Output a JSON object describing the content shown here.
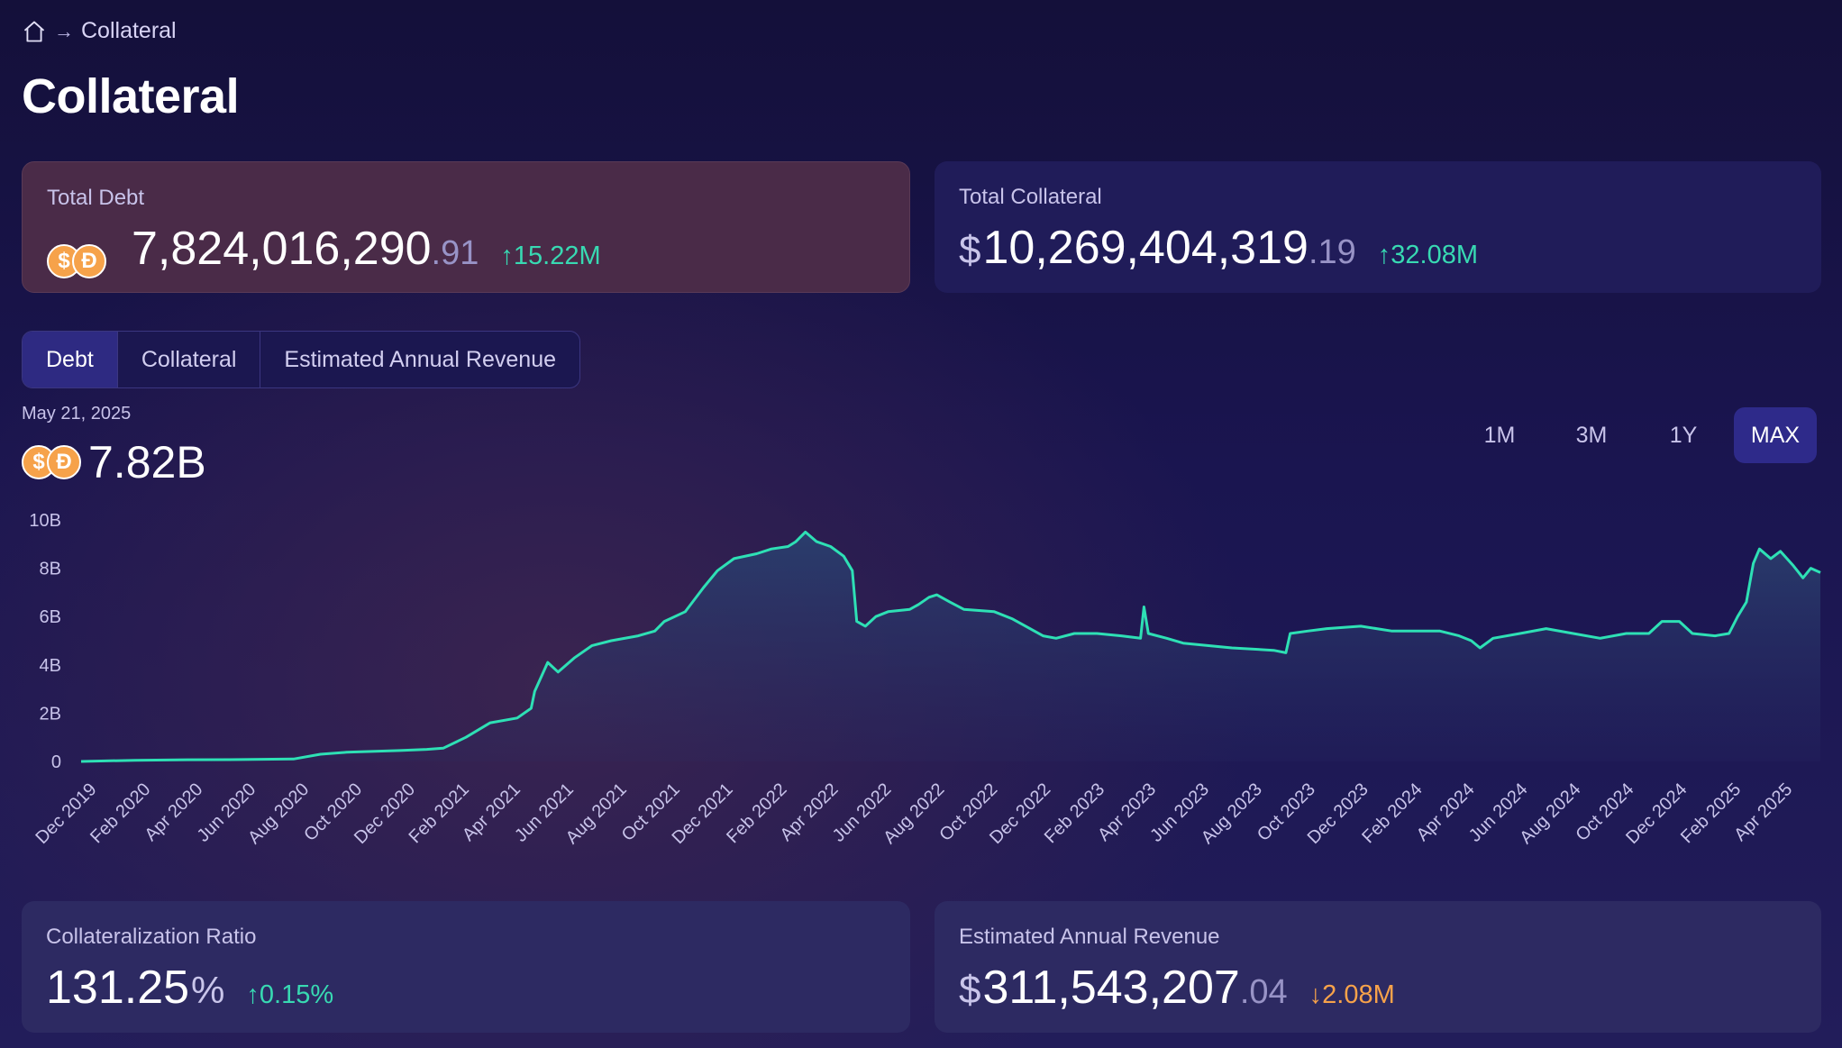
{
  "breadcrumb": {
    "current": "Collateral"
  },
  "page_title": "Collateral",
  "total_debt": {
    "label": "Total Debt",
    "value": "7,824,016,290",
    "cents": ".91",
    "change": "↑15.22M"
  },
  "total_collateral": {
    "label": "Total Collateral",
    "currency": "$",
    "value": "10,269,404,319",
    "cents": ".19",
    "change": "↑32.08M"
  },
  "tabs": [
    {
      "label": "Debt",
      "active": true
    },
    {
      "label": "Collateral",
      "active": false
    },
    {
      "label": "Estimated Annual Revenue",
      "active": false
    }
  ],
  "selected": {
    "date": "May 21, 2025",
    "value": "7.82B"
  },
  "ranges": [
    {
      "label": "1M",
      "active": false
    },
    {
      "label": "3M",
      "active": false
    },
    {
      "label": "1Y",
      "active": false
    },
    {
      "label": "MAX",
      "active": true
    }
  ],
  "collateralization_ratio": {
    "label": "Collateralization Ratio",
    "value": "131.25",
    "unit": "%",
    "change": "↑0.15%"
  },
  "estimated_annual_revenue": {
    "label": "Estimated Annual Revenue",
    "currency": "$",
    "value": "311,543,207",
    "cents": ".04",
    "change": "↓2.08M"
  },
  "colors": {
    "line": "#2ee0b5",
    "up": "#38d9b2",
    "down": "#f7a24a",
    "coin": "#f6a24a"
  },
  "chart_data": {
    "type": "area",
    "ylim": [
      0,
      10
    ],
    "y_ticks": [
      "10B",
      "8B",
      "6B",
      "4B",
      "2B",
      "0"
    ],
    "x_ticks": [
      "Dec 2019",
      "Feb 2020",
      "Apr 2020",
      "Jun 2020",
      "Aug 2020",
      "Oct 2020",
      "Dec 2020",
      "Feb 2021",
      "Apr 2021",
      "Jun 2021",
      "Aug 2021",
      "Oct 2021",
      "Dec 2021",
      "Feb 2022",
      "Apr 2022",
      "Jun 2022",
      "Aug 2022",
      "Oct 2022",
      "Dec 2022",
      "Feb 2023",
      "Apr 2023",
      "Jun 2023",
      "Aug 2023",
      "Oct 2023",
      "Dec 2023",
      "Feb 2024",
      "Apr 2024",
      "Jun 2024",
      "Aug 2024",
      "Oct 2024",
      "Dec 2024",
      "Feb 2025",
      "Apr 2025"
    ],
    "series": [
      {
        "unit": "B",
        "points": [
          [
            "2019-12-01",
            0.0
          ],
          [
            "2020-02-01",
            0.05
          ],
          [
            "2020-04-01",
            0.07
          ],
          [
            "2020-06-01",
            0.08
          ],
          [
            "2020-08-01",
            0.1
          ],
          [
            "2020-09-01",
            0.3
          ],
          [
            "2020-10-01",
            0.38
          ],
          [
            "2020-12-01",
            0.45
          ],
          [
            "2021-01-01",
            0.5
          ],
          [
            "2021-01-20",
            0.55
          ],
          [
            "2021-02-15",
            1.0
          ],
          [
            "2021-03-15",
            1.6
          ],
          [
            "2021-04-15",
            1.8
          ],
          [
            "2021-05-01",
            2.2
          ],
          [
            "2021-05-05",
            2.9
          ],
          [
            "2021-05-20",
            4.1
          ],
          [
            "2021-06-01",
            3.7
          ],
          [
            "2021-06-20",
            4.3
          ],
          [
            "2021-07-10",
            4.8
          ],
          [
            "2021-08-01",
            5.0
          ],
          [
            "2021-09-01",
            5.2
          ],
          [
            "2021-09-20",
            5.4
          ],
          [
            "2021-10-01",
            5.8
          ],
          [
            "2021-10-25",
            6.2
          ],
          [
            "2021-11-15",
            7.2
          ],
          [
            "2021-12-01",
            7.9
          ],
          [
            "2021-12-20",
            8.4
          ],
          [
            "2022-01-15",
            8.6
          ],
          [
            "2022-02-01",
            8.8
          ],
          [
            "2022-02-20",
            8.9
          ],
          [
            "2022-03-01",
            9.1
          ],
          [
            "2022-03-12",
            9.5
          ],
          [
            "2022-03-25",
            9.1
          ],
          [
            "2022-04-10",
            8.9
          ],
          [
            "2022-04-25",
            8.5
          ],
          [
            "2022-05-05",
            7.9
          ],
          [
            "2022-05-10",
            5.8
          ],
          [
            "2022-05-20",
            5.6
          ],
          [
            "2022-06-01",
            6.0
          ],
          [
            "2022-06-15",
            6.2
          ],
          [
            "2022-07-10",
            6.3
          ],
          [
            "2022-07-20",
            6.5
          ],
          [
            "2022-08-01",
            6.8
          ],
          [
            "2022-08-10",
            6.9
          ],
          [
            "2022-08-25",
            6.6
          ],
          [
            "2022-09-10",
            6.3
          ],
          [
            "2022-10-15",
            6.2
          ],
          [
            "2022-11-05",
            5.9
          ],
          [
            "2022-11-25",
            5.5
          ],
          [
            "2022-12-10",
            5.2
          ],
          [
            "2022-12-25",
            5.1
          ],
          [
            "2023-01-15",
            5.3
          ],
          [
            "2023-02-10",
            5.3
          ],
          [
            "2023-03-10",
            5.2
          ],
          [
            "2023-04-01",
            5.1
          ],
          [
            "2023-04-05",
            6.4
          ],
          [
            "2023-04-10",
            5.3
          ],
          [
            "2023-05-01",
            5.1
          ],
          [
            "2023-05-20",
            4.9
          ],
          [
            "2023-07-15",
            4.7
          ],
          [
            "2023-09-01",
            4.6
          ],
          [
            "2023-09-15",
            4.5
          ],
          [
            "2023-09-20",
            5.3
          ],
          [
            "2023-10-10",
            5.4
          ],
          [
            "2023-11-01",
            5.5
          ],
          [
            "2023-12-10",
            5.6
          ],
          [
            "2024-01-15",
            5.4
          ],
          [
            "2024-03-10",
            5.4
          ],
          [
            "2024-04-01",
            5.2
          ],
          [
            "2024-04-15",
            5.0
          ],
          [
            "2024-04-25",
            4.7
          ],
          [
            "2024-05-10",
            5.1
          ],
          [
            "2024-06-10",
            5.3
          ],
          [
            "2024-07-10",
            5.5
          ],
          [
            "2024-08-10",
            5.3
          ],
          [
            "2024-09-10",
            5.1
          ],
          [
            "2024-10-10",
            5.3
          ],
          [
            "2024-11-05",
            5.3
          ],
          [
            "2024-11-20",
            5.8
          ],
          [
            "2024-12-10",
            5.8
          ],
          [
            "2024-12-25",
            5.3
          ],
          [
            "2025-01-20",
            5.2
          ],
          [
            "2025-02-05",
            5.3
          ],
          [
            "2025-02-15",
            6.0
          ],
          [
            "2025-02-25",
            6.6
          ],
          [
            "2025-03-05",
            8.2
          ],
          [
            "2025-03-12",
            8.8
          ],
          [
            "2025-03-25",
            8.4
          ],
          [
            "2025-04-05",
            8.7
          ],
          [
            "2025-04-20",
            8.1
          ],
          [
            "2025-05-01",
            7.6
          ],
          [
            "2025-05-10",
            8.0
          ],
          [
            "2025-05-21",
            7.82
          ]
        ]
      }
    ]
  }
}
